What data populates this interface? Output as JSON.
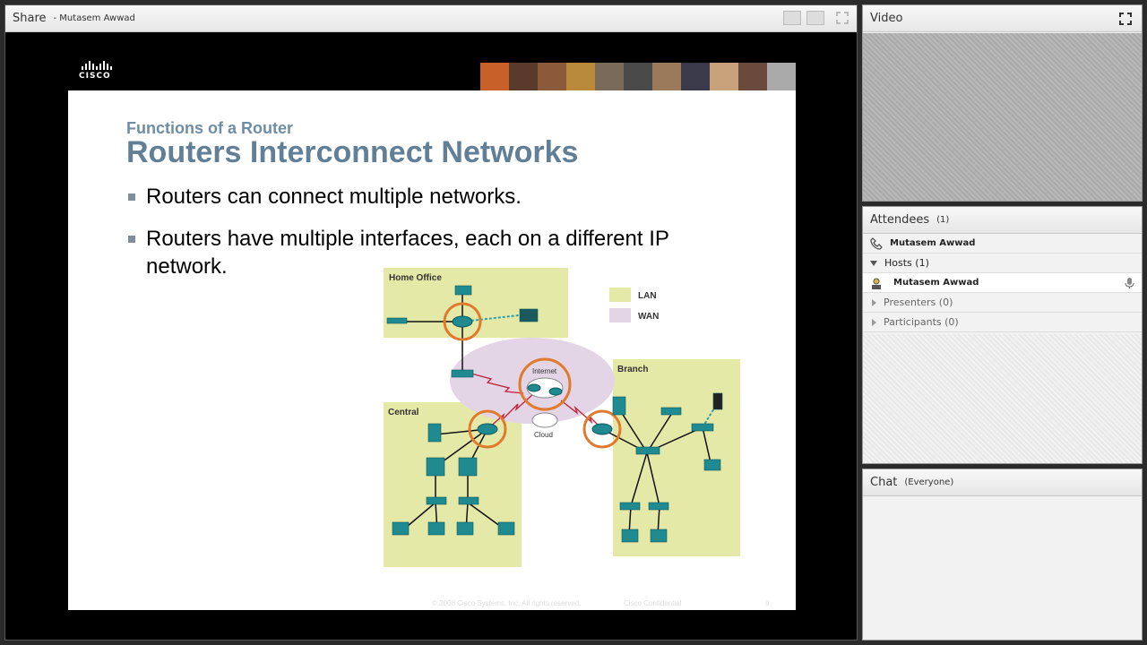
{
  "share": {
    "title": "Share",
    "presenter": "- Mutasem Awwad"
  },
  "slide": {
    "subtitle": "Functions of a Router",
    "title": "Routers Interconnect Networks",
    "bullets": [
      "Routers can connect multiple networks.",
      "Routers have multiple interfaces, each on a different IP network."
    ],
    "footer_copyright": "© 2008 Cisco Systems, Inc. All rights reserved.",
    "footer_confidential": "Cisco Confidential",
    "page_number": "9",
    "logo_text": "CISCO"
  },
  "diagram": {
    "home_office": "Home Office",
    "central": "Central",
    "branch": "Branch",
    "internet": "Internet",
    "cloud": "Cloud",
    "legend_lan": "LAN",
    "legend_wan": "WAN",
    "lan_color": "#e5e9a8",
    "wan_color": "#e3d4e6",
    "router_ring_color": "#e07a2e",
    "device_color": "#1f8a8f"
  },
  "video": {
    "title": "Video"
  },
  "attendees": {
    "title": "Attendees",
    "count": "(1)",
    "me": "Mutasem Awwad",
    "hosts_label": "Hosts (1)",
    "host_name": "Mutasem Awwad",
    "presenters_label": "Presenters (0)",
    "participants_label": "Participants (0)"
  },
  "chat": {
    "title": "Chat",
    "scope": "(Everyone)"
  }
}
